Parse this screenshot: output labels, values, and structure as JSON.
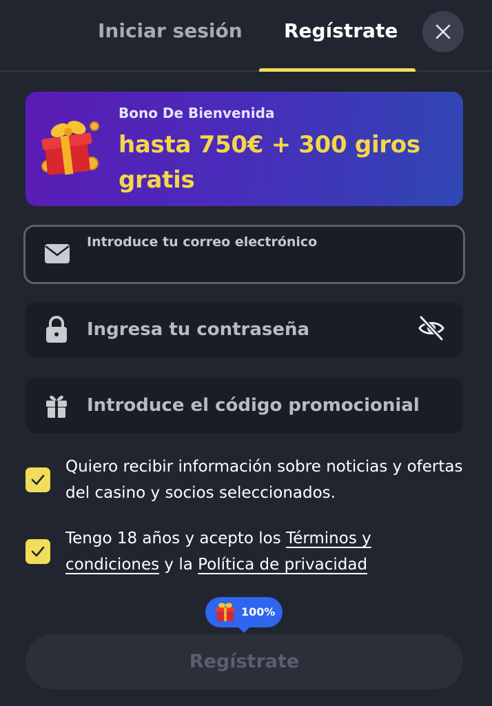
{
  "tabs": {
    "login": "Iniciar sesión",
    "register": "Regístrate"
  },
  "banner": {
    "subtitle": "Bono De Bienvenida",
    "title": "hasta 750€ + 300 giros gratis"
  },
  "fields": {
    "email_label": "Introduce tu correo electrónico",
    "password_placeholder": "Ingresa tu contraseña",
    "promo_placeholder": "Introduce el código promocionial"
  },
  "consents": {
    "marketing": "Quiero recibir información sobre noticias y ofertas del casino y socios seleccionados.",
    "terms_prefix": "Tengo 18 años y acepto los ",
    "terms_link": "Términos y condiciones",
    "terms_middle": " y la ",
    "privacy_link": "Política de privacidad"
  },
  "progress_badge": {
    "text": "100%",
    "value": 1.0
  },
  "submit_label": "Regístrate",
  "colors": {
    "background": "#21252f",
    "accent": "#f0de5a",
    "badge": "#2e66f0",
    "banner_title": "#f5d64a"
  },
  "icons": [
    "close-icon",
    "gift-icon",
    "mail-icon",
    "lock-icon",
    "eye-off-icon",
    "gift-box-icon",
    "check-icon"
  ]
}
